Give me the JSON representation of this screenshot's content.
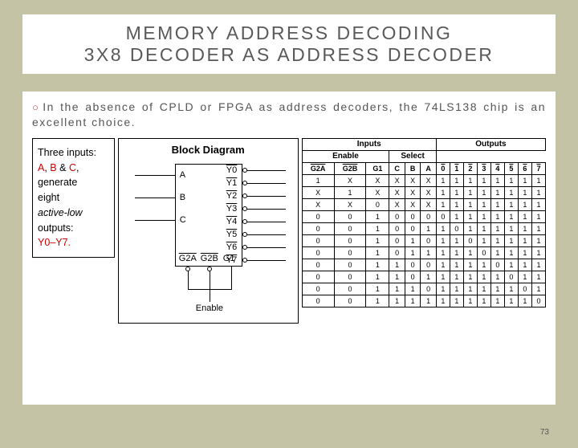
{
  "title_l1": "MEMORY ADDRESS DECODING",
  "title_l2": "3X8 DECODER AS ADDRESS DECODER",
  "bullet": "In the absence of CPLD or FPGA as address decoders, the 74LS138 chip is an excellent choice.",
  "desc": {
    "pre": "Three inputs:",
    "a": "A",
    "b": "B",
    "c": "C",
    "mid": ", generate eight",
    "gen": "eight",
    "it": "active-low",
    "out": "outputs:",
    "y": "Y0–Y7."
  },
  "block": {
    "title": "Block Diagram",
    "inA": "A",
    "inB": "B",
    "inC": "C",
    "g2a": "G2A",
    "g2b": "G2B",
    "g1": "G1",
    "enable": "Enable",
    "y": [
      "Y0",
      "Y1",
      "Y2",
      "Y3",
      "Y4",
      "Y5",
      "Y6",
      "Y7"
    ]
  },
  "tt": {
    "h1": "Inputs",
    "h2": "Outputs",
    "en": "Enable",
    "sel": "Select",
    "cols": [
      "G2A",
      "G2B",
      "G1",
      "C",
      "B",
      "A",
      "0",
      "1",
      "2",
      "3",
      "4",
      "5",
      "6",
      "7"
    ],
    "rows": [
      [
        "1",
        "X",
        "X",
        "X",
        "X",
        "X",
        "1",
        "1",
        "1",
        "1",
        "1",
        "1",
        "1",
        "1"
      ],
      [
        "X",
        "1",
        "X",
        "X",
        "X",
        "X",
        "1",
        "1",
        "1",
        "1",
        "1",
        "1",
        "1",
        "1"
      ],
      [
        "X",
        "X",
        "0",
        "X",
        "X",
        "X",
        "1",
        "1",
        "1",
        "1",
        "1",
        "1",
        "1",
        "1"
      ],
      [
        "0",
        "0",
        "1",
        "0",
        "0",
        "0",
        "0",
        "1",
        "1",
        "1",
        "1",
        "1",
        "1",
        "1"
      ],
      [
        "0",
        "0",
        "1",
        "0",
        "0",
        "1",
        "1",
        "0",
        "1",
        "1",
        "1",
        "1",
        "1",
        "1"
      ],
      [
        "0",
        "0",
        "1",
        "0",
        "1",
        "0",
        "1",
        "1",
        "0",
        "1",
        "1",
        "1",
        "1",
        "1"
      ],
      [
        "0",
        "0",
        "1",
        "0",
        "1",
        "1",
        "1",
        "1",
        "1",
        "0",
        "1",
        "1",
        "1",
        "1"
      ],
      [
        "0",
        "0",
        "1",
        "1",
        "0",
        "0",
        "1",
        "1",
        "1",
        "1",
        "0",
        "1",
        "1",
        "1"
      ],
      [
        "0",
        "0",
        "1",
        "1",
        "0",
        "1",
        "1",
        "1",
        "1",
        "1",
        "1",
        "0",
        "1",
        "1"
      ],
      [
        "0",
        "0",
        "1",
        "1",
        "1",
        "0",
        "1",
        "1",
        "1",
        "1",
        "1",
        "1",
        "0",
        "1"
      ],
      [
        "0",
        "0",
        "1",
        "1",
        "1",
        "1",
        "1",
        "1",
        "1",
        "1",
        "1",
        "1",
        "1",
        "0"
      ]
    ]
  },
  "page": "73"
}
